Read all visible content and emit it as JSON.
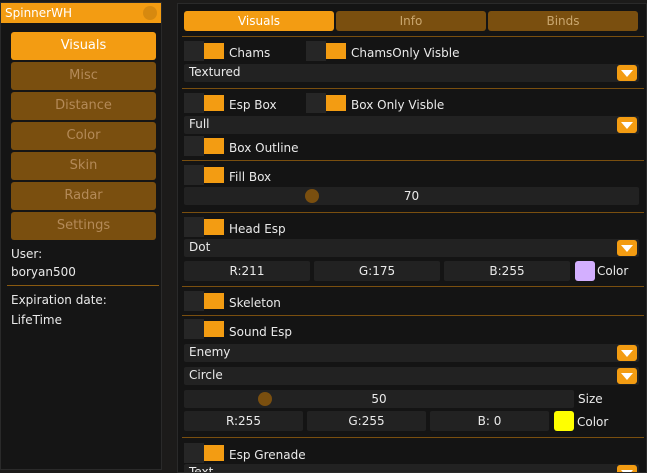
{
  "left": {
    "title": "SpinnerWH",
    "menu": [
      "Visuals",
      "Misc",
      "Distance",
      "Color",
      "Skin",
      "Radar",
      "Settings"
    ],
    "user_label": "User:",
    "user_name": "boryan500",
    "expiration_label": "Expiration date:",
    "expiration_value": "LifeTime"
  },
  "tabs": [
    "Visuals",
    "Info",
    "Binds"
  ],
  "visuals": {
    "chams": "Chams",
    "chams_only_visible": "ChamsOnly Visble",
    "chams_mode": "Textured",
    "esp_box": "Esp Box",
    "box_only_visible": "Box Only Visble",
    "box_mode": "Full",
    "box_outline": "Box Outline",
    "fill_box": "Fill Box",
    "fill_value": "70",
    "fill_value_fraction": 0.7,
    "head_esp": "Head Esp",
    "head_mode": "Dot",
    "head_r": "R:211",
    "head_g": "G:175",
    "head_b": "B:255",
    "head_color_label": "Color",
    "head_color_hex": "#d3afff",
    "skeleton": "Skeleton",
    "sound_esp": "Sound Esp",
    "sound_target": "Enemy",
    "sound_shape": "Circle",
    "sound_size_value": "50",
    "sound_size_fraction": 0.5,
    "sound_size_label": "Size",
    "sound_r": "R:255",
    "sound_g": "G:255",
    "sound_b": "B:  0",
    "sound_color_label": "Color",
    "sound_color_hex": "#ffff00",
    "esp_grenade": "Esp Grenade",
    "grenade_mode": "Text"
  },
  "colors": {
    "accent": "#f39c12",
    "accent_dark": "#7a4f0f"
  }
}
